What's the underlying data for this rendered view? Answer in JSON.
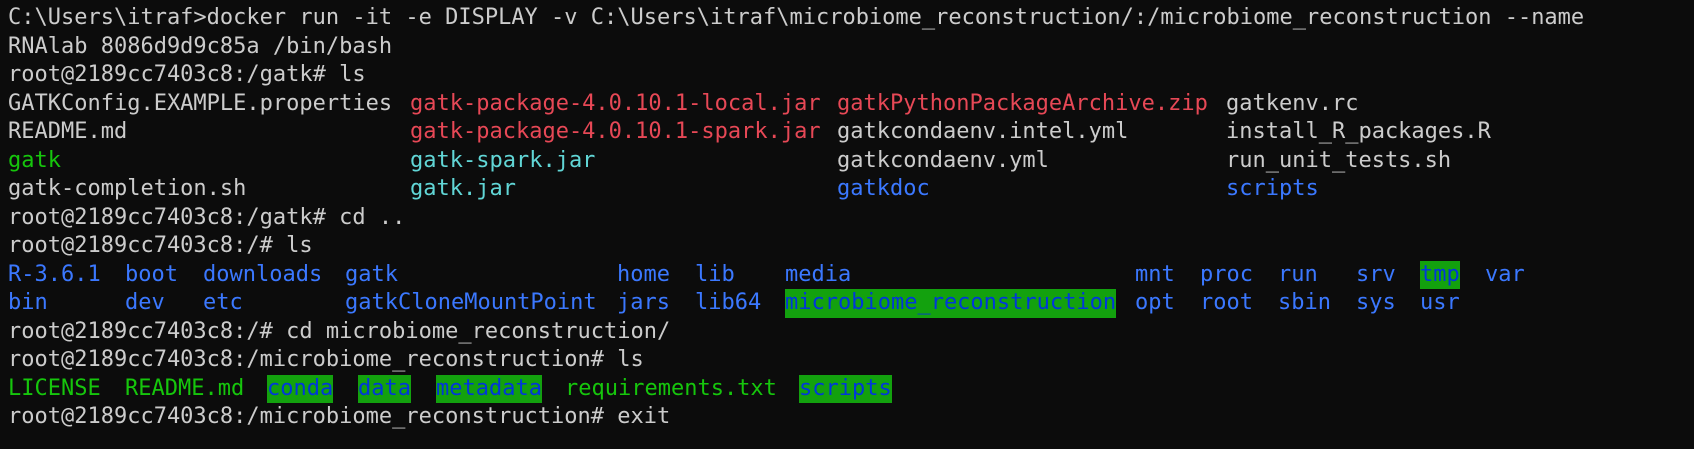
{
  "terminal": {
    "line1": "C:\\Users\\itraf>docker run -it -e DISPLAY -v C:\\Users\\itraf\\microbiome_reconstruction/:/microbiome_reconstruction --name",
    "line2": "RNAlab 8086d9d9c85a /bin/bash",
    "prompt_gatk_ls": "root@2189cc7403c8:/gatk# ls",
    "ls_gatk": {
      "r1": [
        "GATKConfig.EXAMPLE.properties",
        "gatk-package-4.0.10.1-local.jar",
        "gatkPythonPackageArchive.zip",
        "gatkenv.rc"
      ],
      "r2": [
        "README.md",
        "gatk-package-4.0.10.1-spark.jar",
        "gatkcondaenv.intel.yml",
        "install_R_packages.R"
      ],
      "r3": [
        "gatk",
        "gatk-spark.jar",
        "gatkcondaenv.yml",
        "run_unit_tests.sh"
      ],
      "r4": [
        "gatk-completion.sh",
        "gatk.jar",
        "gatkdoc",
        "scripts"
      ]
    },
    "prompt_cd_up": "root@2189cc7403c8:/gatk# cd ..",
    "prompt_root_ls": "root@2189cc7403c8:/# ls",
    "ls_root": {
      "r1": [
        "R-3.6.1",
        "boot",
        "downloads",
        "gatk",
        "home",
        "lib",
        "media",
        "mnt",
        "proc",
        "run",
        "srv",
        "tmp",
        "var"
      ],
      "r2": [
        "bin",
        "dev",
        "etc",
        "gatkCloneMountPoint",
        "jars",
        "lib64",
        "microbiome_reconstruction",
        "opt",
        "root",
        "sbin",
        "sys",
        "usr"
      ]
    },
    "prompt_cd_micro": "root@2189cc7403c8:/# cd microbiome_reconstruction/",
    "prompt_micro_ls": "root@2189cc7403c8:/microbiome_reconstruction# ls",
    "ls_micro": [
      "LICENSE",
      "README.md",
      "conda",
      "data",
      "metadata",
      "requirements.txt",
      "scripts"
    ],
    "prompt_exit": "root@2189cc7403c8:/microbiome_reconstruction# exit"
  },
  "colors": {
    "background": "#0c0c0c",
    "text": "#cccccc",
    "archive_red": "#e74856",
    "symlink_cyan": "#61d6d6",
    "directory_blue": "#3b78ff",
    "executable_green": "#16c60c",
    "sticky_dir_bg": "#13a10e",
    "sticky_dir_fg": "#0037da"
  }
}
